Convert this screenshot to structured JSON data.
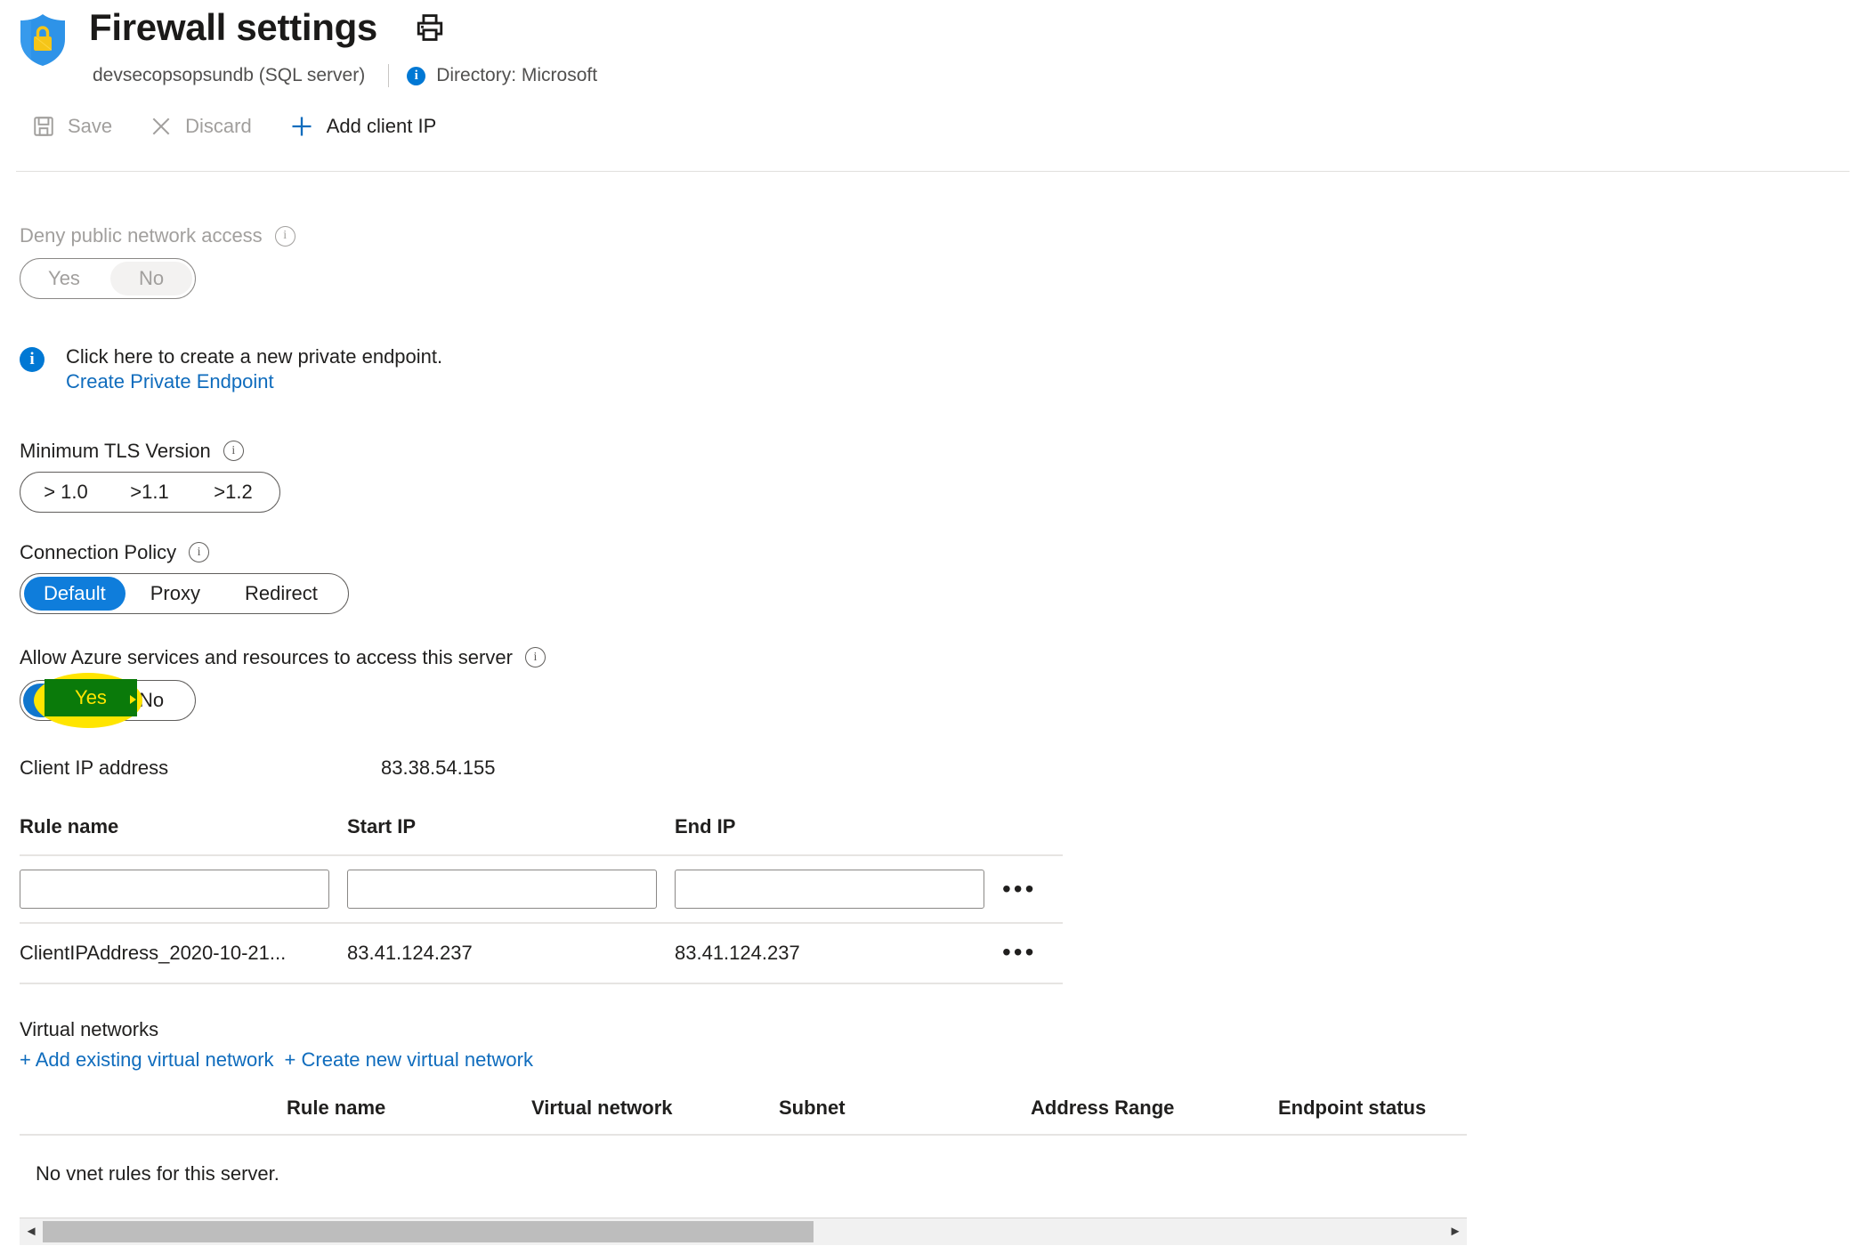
{
  "header": {
    "title": "Firewall settings",
    "shield_icon": "shield-lock-icon",
    "print_icon": "print-icon",
    "subtitle": "devsecopsopsundb (SQL server)",
    "directory": "Directory: Microsoft",
    "info_glyph": "i"
  },
  "toolbar": {
    "save_label": "Save",
    "discard_label": "Discard",
    "add_client_ip_label": "Add client IP"
  },
  "deny_public_network": {
    "label": "Deny public network access",
    "options": [
      "Yes",
      "No"
    ],
    "selected": "No",
    "disabled": true
  },
  "private_endpoint": {
    "message": "Click here to create a new private endpoint.",
    "link": "Create Private Endpoint"
  },
  "tls": {
    "label": "Minimum TLS Version",
    "options": [
      "> 1.0",
      ">1.1",
      ">1.2"
    ],
    "selected": ""
  },
  "connection_policy": {
    "label": "Connection Policy",
    "options": [
      "Default",
      "Proxy",
      "Redirect"
    ],
    "selected": "Default"
  },
  "allow_azure": {
    "label": "Allow Azure services and resources to access this server",
    "options": [
      "Yes",
      "No"
    ],
    "selected": "Yes",
    "annotation_label": "Yes",
    "highlight_color": "#ffe500",
    "box_color": "#0a7a0a",
    "text_color": "#ffe500"
  },
  "client_ip": {
    "label": "Client IP address",
    "value": "83.38.54.155"
  },
  "firewall_rules": {
    "columns": [
      "Rule name",
      "Start IP",
      "End IP"
    ],
    "new_row": {
      "rule_name": "",
      "start_ip": "",
      "end_ip": "",
      "menu": "•••"
    },
    "rows": [
      {
        "rule_name": "ClientIPAddress_2020-10-21...",
        "start_ip": "83.41.124.237",
        "end_ip": "83.41.124.237",
        "menu": "•••"
      }
    ]
  },
  "virtual_networks": {
    "title": "Virtual networks",
    "add_existing_link": "+ Add existing virtual network",
    "create_new_link": "+ Create new virtual network",
    "columns": [
      "Rule name",
      "Virtual network",
      "Subnet",
      "Address Range",
      "Endpoint status"
    ],
    "empty_message": "No vnet rules for this server."
  },
  "colors": {
    "accent_blue": "#0078d4",
    "link_blue": "#0f6cbd",
    "selected_pill": "#0f7ddb",
    "disabled_text": "#a19f9d",
    "text": "#201f1e"
  }
}
